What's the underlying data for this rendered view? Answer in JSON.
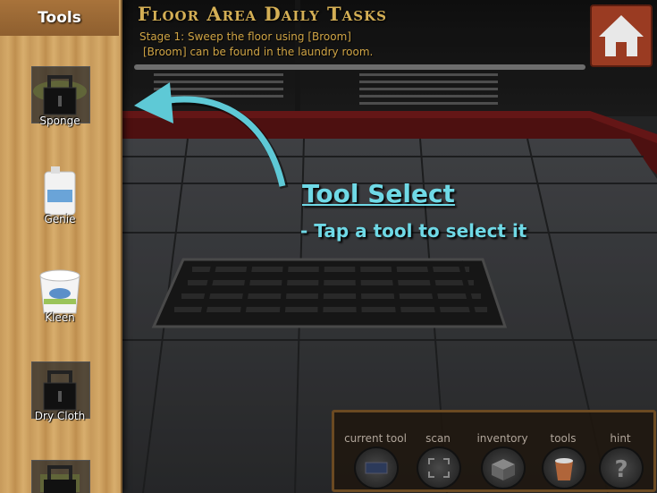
{
  "sidebar": {
    "title": "Tools",
    "tools": [
      {
        "label": "Sponge",
        "locked": true
      },
      {
        "label": "Genie",
        "locked": false
      },
      {
        "label": "Kleen",
        "locked": false
      },
      {
        "label": "Dry Cloth",
        "locked": true
      }
    ]
  },
  "task_panel": {
    "title": "Floor Area Daily Tasks",
    "line1": "Stage 1: Sweep the floor using [Broom]",
    "line2": "[Broom] can be found in the laundry room."
  },
  "tutorial": {
    "title": "Tool Select",
    "subtitle": "- Tap a tool to select it"
  },
  "toolbar": {
    "current_tool": "current tool",
    "scan": "scan",
    "inventory": "inventory",
    "tools": "tools",
    "hint": "hint"
  },
  "colors": {
    "tutorial_cyan": "#6fd9e6",
    "task_gold": "#d4af55",
    "home_red": "#9a3b22"
  },
  "icons": [
    "home-icon",
    "lock-icon",
    "arrow-curve-icon",
    "scan-icon",
    "inventory-box-icon",
    "bucket-icon",
    "question-icon"
  ]
}
